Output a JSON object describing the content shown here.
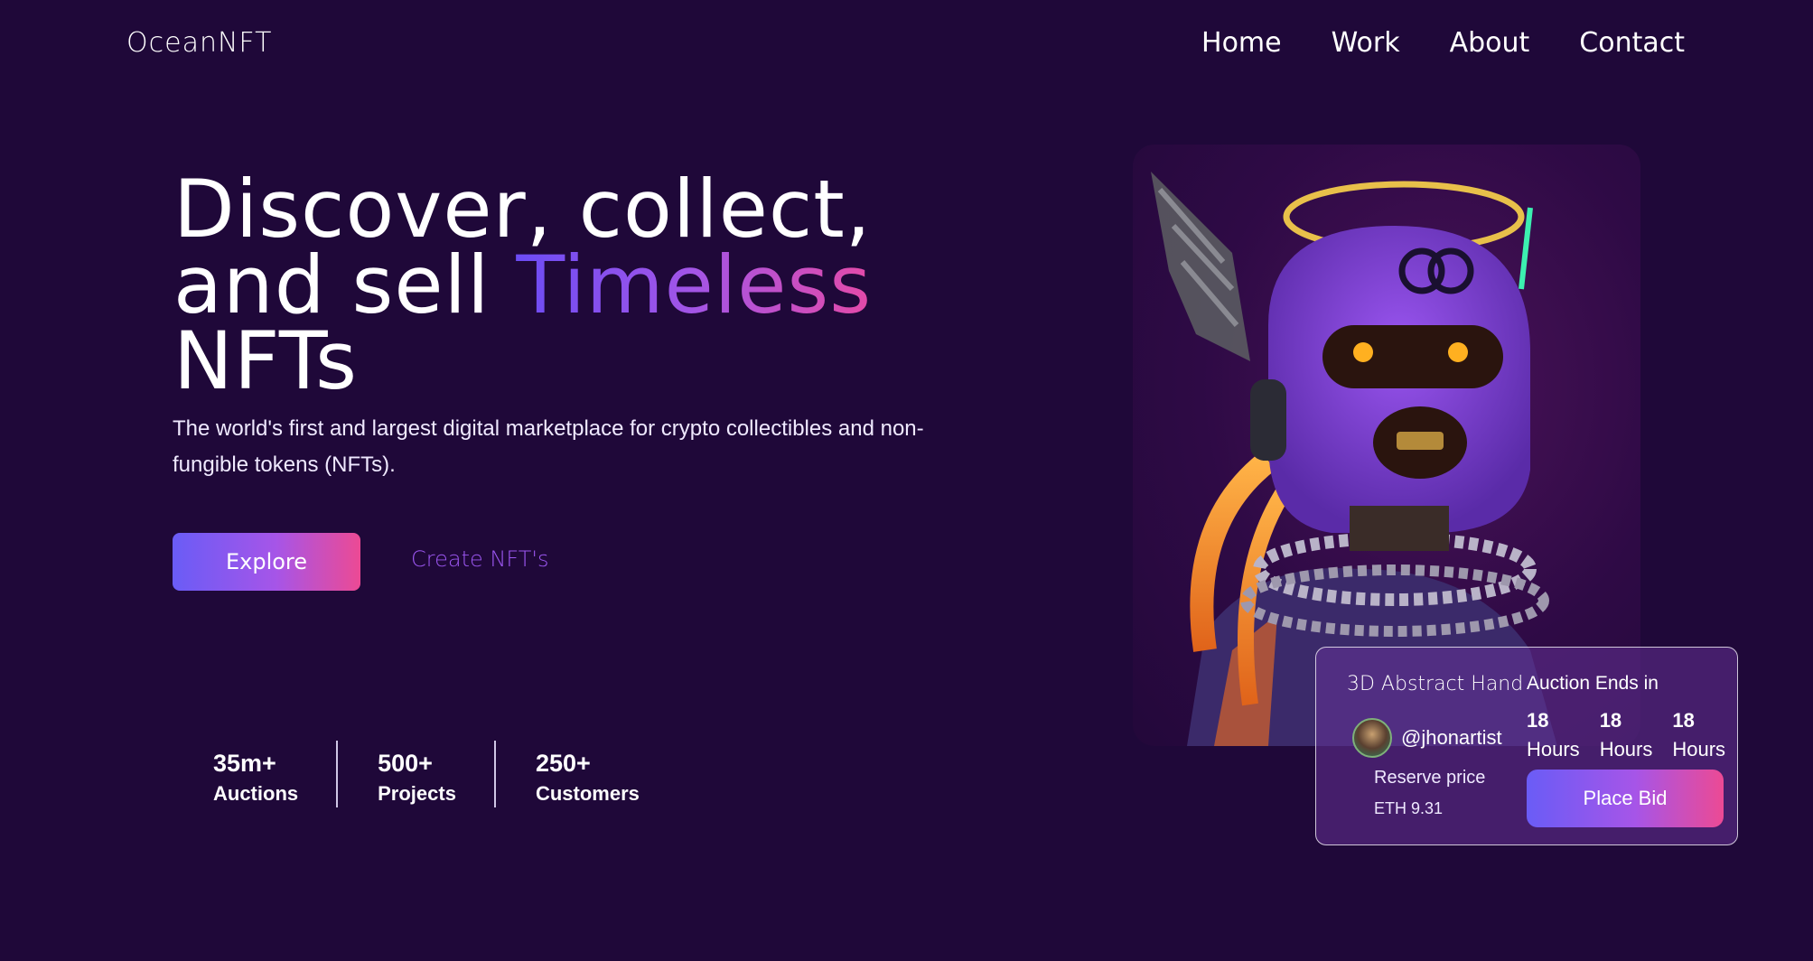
{
  "brand": {
    "logo": "OceanNFT"
  },
  "nav": {
    "items": [
      "Home",
      "Work",
      "About",
      "Contact"
    ]
  },
  "hero": {
    "title_line1": "Discover, collect,",
    "title_line2_prefix": "and sell",
    "title_highlight": "Timeless",
    "title_line3": "NFTs",
    "subtitle": "The world's first and largest digital marketplace for crypto collectibles and non-fungible tokens (NFTs).",
    "explore_label": "Explore",
    "create_label": "Create NFT's"
  },
  "stats": [
    {
      "value": "35m+",
      "label": "Auctions"
    },
    {
      "value": "500+",
      "label": "Projects"
    },
    {
      "value": "250+",
      "label": "Customers"
    }
  ],
  "card": {
    "title": "3D Abstract Hand",
    "artist": "@jhonartist",
    "reserve_label": "Reserve price",
    "reserve_value": "ETH 9.31",
    "auction_title": "Auction Ends in",
    "timer": [
      {
        "value": "18",
        "unit": "Hours"
      },
      {
        "value": "18",
        "unit": "Hours"
      },
      {
        "value": "18",
        "unit": "Hours"
      }
    ],
    "bid_label": "Place Bid"
  },
  "colors": {
    "background": "#1f0839",
    "accent_start": "#6a5cf6",
    "accent_mid": "#a655e8",
    "accent_end": "#ec4a94",
    "link": "#9b56f0"
  },
  "icons": {
    "artwork": "nft-character-image",
    "avatar": "artist-avatar"
  }
}
